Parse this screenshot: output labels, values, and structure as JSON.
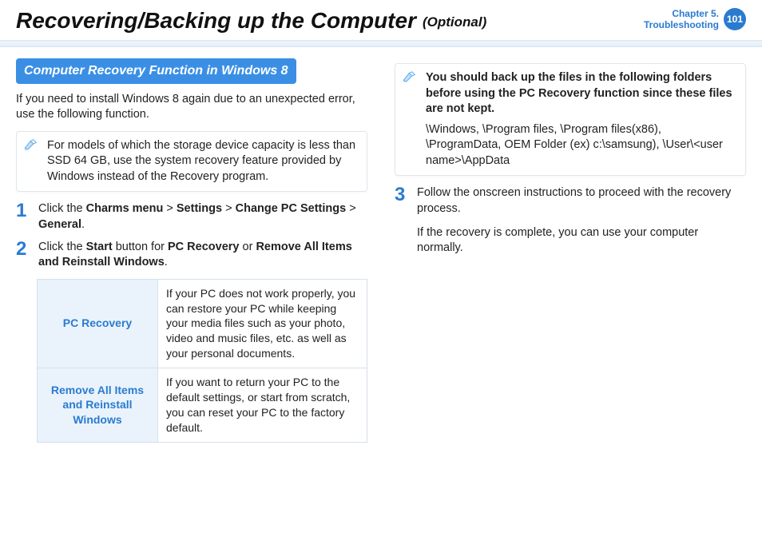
{
  "header": {
    "title": "Recovering/Backing up the Computer",
    "subtitle": "(Optional)",
    "chapter_line1": "Chapter 5.",
    "chapter_line2": "Troubleshooting",
    "page_number": "101"
  },
  "left": {
    "section_title": "Computer Recovery Function in Windows 8",
    "intro": "If you need to install Windows 8 again due to an unexpected error, use the following function.",
    "note1": "For models of which the storage device capacity is less than SSD 64 GB, use the system recovery feature provided by Windows instead of the Recovery program.",
    "step1_num": "1",
    "step1_a": "Click the ",
    "step1_b": "Charms menu",
    "step1_c": " > ",
    "step1_d": "Settings",
    "step1_e": " > ",
    "step1_f": "Change PC Settings",
    "step1_g": " > ",
    "step1_h": "General",
    "step1_i": ".",
    "step2_num": "2",
    "step2_a": "Click the ",
    "step2_b": "Start",
    "step2_c": " button for ",
    "step2_d": "PC Recovery",
    "step2_e": " or ",
    "step2_f": "Remove All Items and Reinstall Windows",
    "step2_g": ".",
    "table": {
      "r1_label": "PC Recovery",
      "r1_text": "If your PC does not work properly, you can restore your PC while keeping your media files such as your photo, video and music files, etc. as well as your personal documents.",
      "r2_label": "Remove All Items and Reinstall Windows",
      "r2_text": "If you want to return your PC to the default settings, or start from scratch, you can reset your PC to the factory default."
    }
  },
  "right": {
    "note_bold": "You should back up the files in the following folders before using the PC Recovery function since these files are not kept.",
    "note_body": "\\Windows, \\Program files, \\Program files(x86), \\ProgramData, OEM Folder (ex) c:\\samsung), \\User\\<user name>\\AppData",
    "step3_num": "3",
    "step3_a": "Follow the onscreen instructions to proceed with the recovery process.",
    "step3_b": "If the recovery is complete, you can use your computer normally."
  }
}
